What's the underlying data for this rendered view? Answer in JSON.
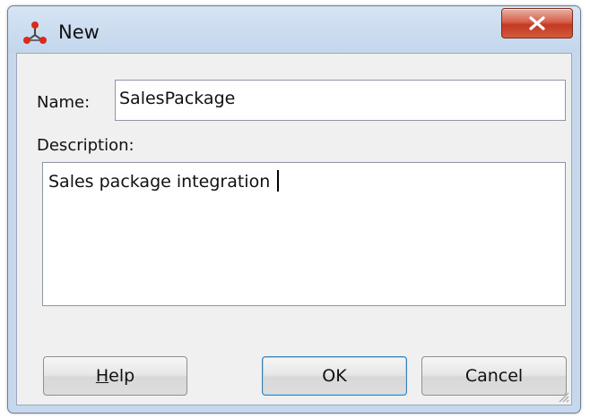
{
  "window": {
    "title": "New",
    "icon": "network-nodes-icon",
    "close_icon": "close-x-icon"
  },
  "form": {
    "name_label": "Name:",
    "name_value": "SalesPackage",
    "description_label": "Description:",
    "description_value": "Sales package integration"
  },
  "buttons": {
    "help_mnemonic": "H",
    "help_rest": "elp",
    "ok": "OK",
    "cancel": "Cancel"
  },
  "colors": {
    "close_button": "#c8452e",
    "default_button_border": "#3c7fb1",
    "title_bar": "#c7d8ec"
  }
}
